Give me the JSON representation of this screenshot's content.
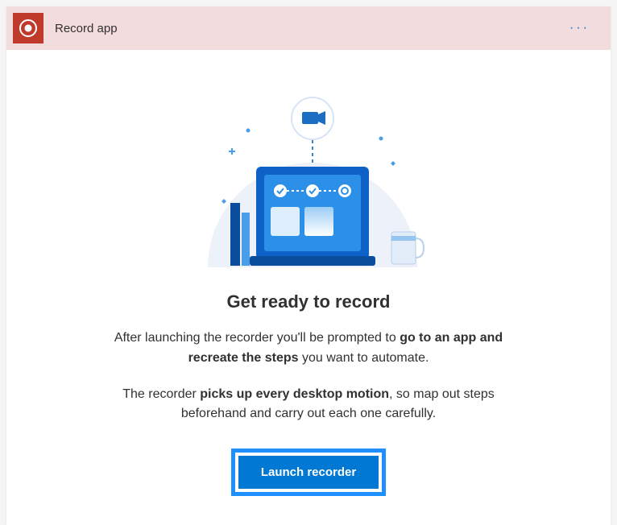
{
  "header": {
    "title": "Record app",
    "icon": "record-circle-icon",
    "more_label": "···"
  },
  "content": {
    "title": "Get ready to record",
    "para1_pre": "After launching the recorder you'll be prompted to ",
    "para1_bold": "go to an app and recreate the steps",
    "para1_post": " you want to automate.",
    "para2_pre": "The recorder ",
    "para2_bold": "picks up every desktop motion",
    "para2_post": ", so map out steps beforehand and carry out each one carefully.",
    "launch_label": "Launch recorder"
  },
  "illustration": {
    "name": "laptop-recording-illustration"
  },
  "colors": {
    "header_bg": "#f3dcdd",
    "record_red": "#c03a2b",
    "primary_blue": "#0078d4",
    "highlight_border": "#1e90ff"
  }
}
